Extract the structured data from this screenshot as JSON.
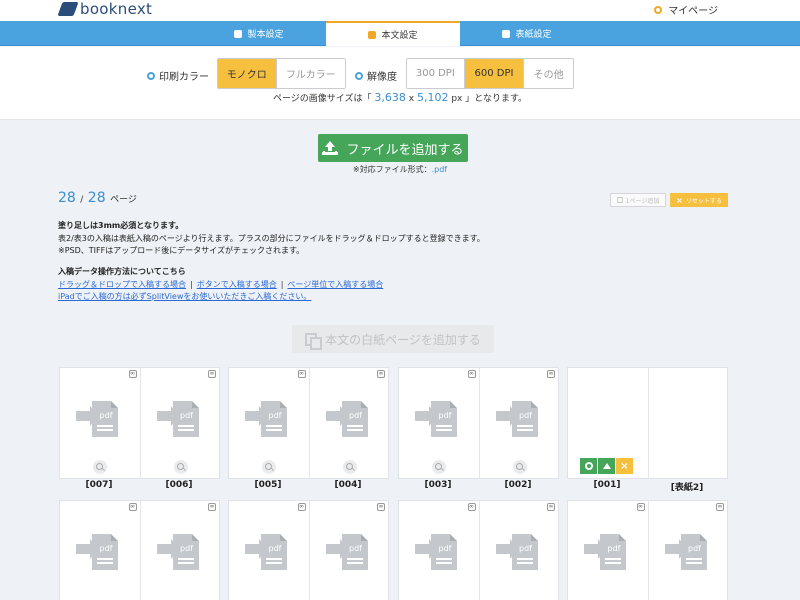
{
  "header": {
    "logo_text": "booknext",
    "mypage_label": "マイページ"
  },
  "tabs": [
    {
      "label": "製本設定"
    },
    {
      "label": "本文設定"
    },
    {
      "label": "表紙設定"
    }
  ],
  "settings": {
    "color_label": "印刷カラー",
    "color_options": [
      "モノクロ",
      "フルカラー"
    ],
    "color_selected": "モノクロ",
    "resolution_label": "解像度",
    "resolution_options": [
      "300 DPI",
      "600 DPI",
      "その他"
    ],
    "resolution_selected": "600 DPI",
    "size_note_prefix": "ページの画像サイズは「",
    "size_w": "3,638",
    "size_x": "x",
    "size_h": "5,102",
    "size_note_suffix": "px 」となります。"
  },
  "upload": {
    "add_file_label": "ファイルを追加する",
    "formats_prefix": "※対応ファイル形式：",
    "formats_value": ".pdf"
  },
  "pagecount": {
    "current": "28",
    "sep": "/",
    "total": "28",
    "unit": "ページ"
  },
  "actions": {
    "one_page_label": "1ページ追加",
    "reset_label": "リセットする"
  },
  "notes": {
    "line1": "塗り足しは3mm必須となります。",
    "line2": "表2/表3の入稿は表紙入稿のページより行えます。プラスの部分にファイルをドラッグ＆ドロップすると登録できます。",
    "line3": "※PSD、TIFFはアップロード後にデータサイズがチェックされます。"
  },
  "guide": {
    "title": "入稿データ操作方法についてこちら",
    "link1": "ドラッグ＆ドロップで入稿する場合",
    "sep1": "|",
    "link2": "ボタンで入稿する場合",
    "sep2": "|",
    "link3": "ページ単位で入稿する場合",
    "link4": "iPadでご入稿の方は必ずSplitViewをお使いいただきご入稿ください。"
  },
  "blank_page_label": "本文の白紙ページを追加する",
  "page_icon_label": "pdf",
  "clip_glyph": "∞",
  "reset_glyph": "×",
  "row1": [
    "[007]",
    "[006]",
    "[005]",
    "[004]",
    "[003]",
    "[002]",
    "[001]",
    "[表紙2]"
  ],
  "row2_spreads": 4
}
